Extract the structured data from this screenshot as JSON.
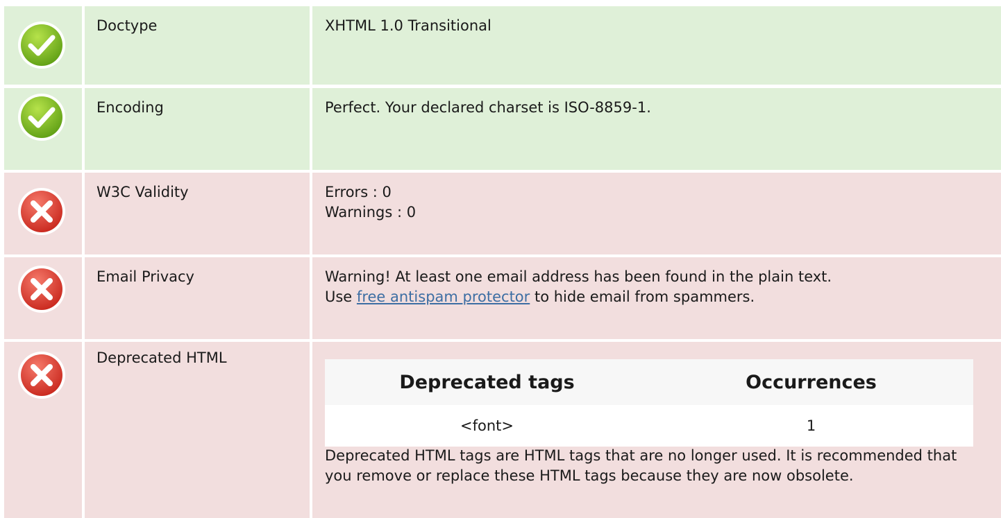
{
  "rows": [
    {
      "status": "pass",
      "label": "Doctype",
      "lines": [
        "XHTML 1.0 Transitional"
      ]
    },
    {
      "status": "pass",
      "label": "Encoding",
      "lines": [
        "Perfect. Your declared charset is ISO-8859-1."
      ]
    },
    {
      "status": "fail",
      "label": "W3C Validity",
      "lines": [
        "Errors : 0",
        "Warnings : 0"
      ]
    },
    {
      "status": "fail",
      "label": "Email Privacy",
      "line1": "Warning! At least one email address has been found in the plain text.",
      "line2_prefix": "Use ",
      "link_text": "free antispam protector",
      "line2_suffix": " to hide email from spammers."
    },
    {
      "status": "fail",
      "label": "Deprecated HTML",
      "table": {
        "headers": [
          "Deprecated tags",
          "Occurrences"
        ],
        "rows": [
          [
            "<font>",
            "1"
          ]
        ]
      },
      "description": "Deprecated HTML tags are HTML tags that are no longer used. It is recommended that you remove or replace these HTML tags because they are now obsolete."
    }
  ],
  "colors": {
    "pass_bg": "#dff0d8",
    "fail_bg": "#f2dede",
    "link": "#3d6ea3"
  },
  "icons": {
    "pass": "check-circle-icon",
    "fail": "x-circle-icon"
  }
}
